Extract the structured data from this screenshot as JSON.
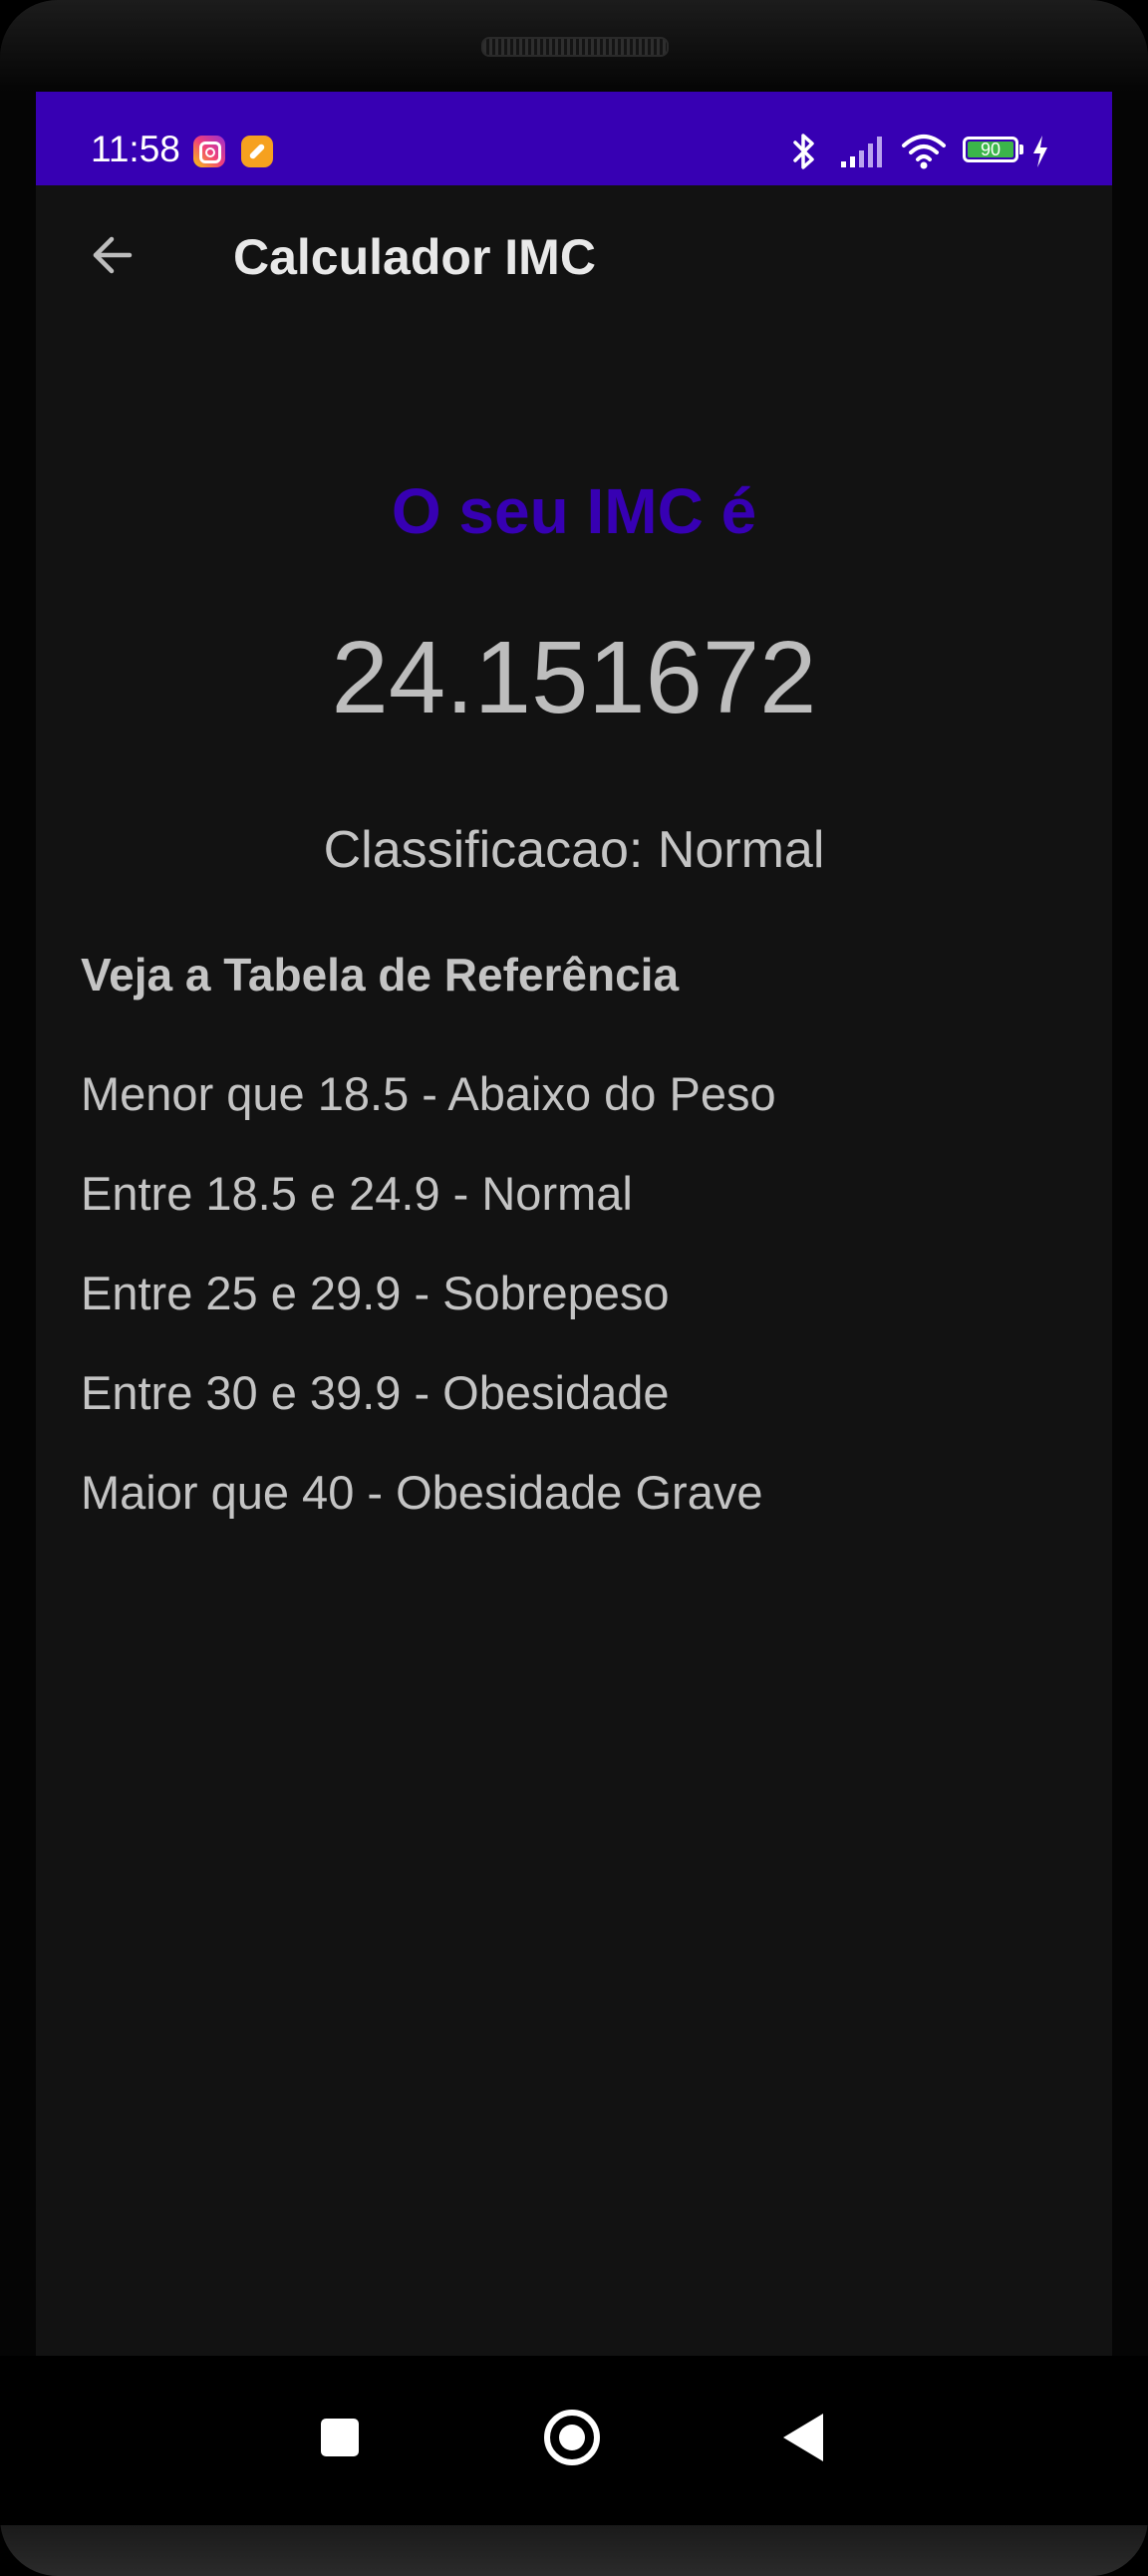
{
  "status_bar": {
    "time": "11:58",
    "notification_icons": [
      "instagram-icon",
      "app-notification-icon"
    ],
    "system_icons": [
      "bluetooth-icon",
      "signal-icon",
      "wifi-icon",
      "battery-icon",
      "charging-icon"
    ],
    "battery_level": "90",
    "background_color": "#3700b3"
  },
  "app_bar": {
    "back_icon": "arrow-left-icon",
    "title": "Calculador IMC"
  },
  "result": {
    "headline": "O seu IMC é",
    "headline_color": "#3700b3",
    "value": "24.151672",
    "classification": "Classificacao: Normal"
  },
  "reference": {
    "title": "Veja a Tabela de Referência",
    "items": [
      "Menor que 18.5 - Abaixo do Peso",
      "Entre 18.5 e 24.9 - Normal",
      "Entre 25 e 29.9 - Sobrepeso",
      "Entre 30 e 39.9 - Obesidade",
      "Maior que 40 - Obesidade Grave"
    ]
  },
  "nav_bar": {
    "buttons": [
      "recents-icon",
      "home-icon",
      "back-triangle-icon"
    ]
  },
  "colors": {
    "background": "#121212",
    "primary": "#3700b3",
    "text": "#c4c4c4"
  }
}
